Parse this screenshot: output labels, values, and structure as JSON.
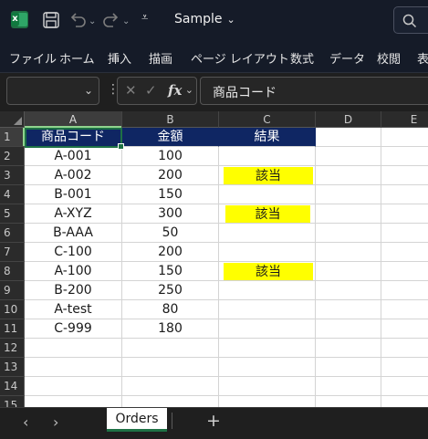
{
  "titlebar": {
    "doc_title": "Sample",
    "icons": [
      "excel-logo",
      "save-icon",
      "undo-icon",
      "redo-icon",
      "customize-qat-icon",
      "search-icon"
    ]
  },
  "ribbon": {
    "tabs": [
      "ファイル",
      "ホーム",
      "挿入",
      "描画",
      "ページ レイアウト",
      "数式",
      "データ",
      "校閲",
      "表"
    ]
  },
  "formula_bar": {
    "name_box": "",
    "content": "商品コード",
    "icons": [
      "cancel-icon",
      "enter-icon",
      "insert-function-icon"
    ]
  },
  "grid": {
    "columns": [
      "A",
      "B",
      "C",
      "D",
      "E"
    ],
    "rows": [
      "1",
      "2",
      "3",
      "4",
      "5",
      "6",
      "7",
      "8",
      "9",
      "10",
      "11",
      "12",
      "13",
      "14",
      "15"
    ],
    "header": [
      "商品コード",
      "金額",
      "結果"
    ],
    "data": [
      {
        "code": "A-001",
        "amount": "100",
        "result": ""
      },
      {
        "code": "A-002",
        "amount": "200",
        "result": "該当"
      },
      {
        "code": "B-001",
        "amount": "150",
        "result": ""
      },
      {
        "code": "A-XYZ",
        "amount": "300",
        "result": "該当"
      },
      {
        "code": "B-AAA",
        "amount": "50",
        "result": ""
      },
      {
        "code": "C-100",
        "amount": "200",
        "result": ""
      },
      {
        "code": "A-100",
        "amount": "150",
        "result": "該当"
      },
      {
        "code": "B-200",
        "amount": "250",
        "result": ""
      },
      {
        "code": "A-test",
        "amount": "80",
        "result": ""
      },
      {
        "code": "C-999",
        "amount": "180",
        "result": ""
      }
    ],
    "active_cell": "A1"
  },
  "sheet_tabs": {
    "tabs": [
      "Orders"
    ],
    "active": "Orders",
    "add_label": "+"
  },
  "colors": {
    "header_fill": "#0f2663",
    "highlight": "#ffff00",
    "accent": "#1e7145"
  }
}
